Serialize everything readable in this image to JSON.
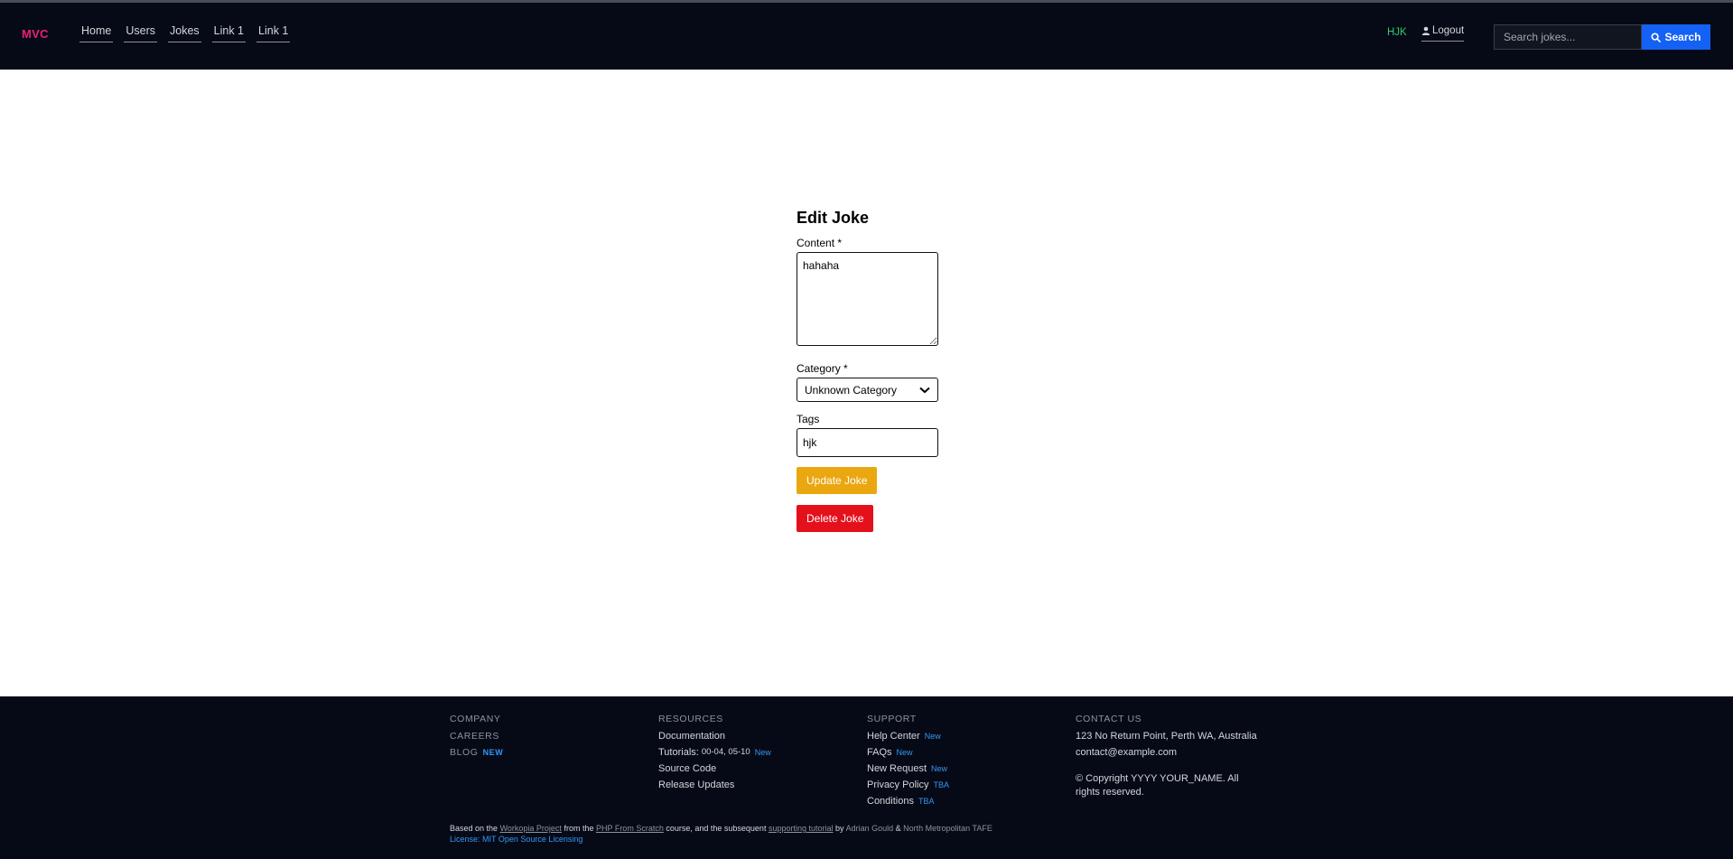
{
  "header": {
    "brand": "MVC",
    "nav": [
      "Home",
      "Users",
      "Jokes",
      "Link 1",
      "Link 1"
    ],
    "user": "HJK",
    "logout": "Logout",
    "search_placeholder": "Search jokes...",
    "search_button": "Search"
  },
  "form": {
    "title": "Edit Joke",
    "content_label": "Content *",
    "content_value": "hahaha",
    "category_label": "Category *",
    "category_value": "Unknown Category",
    "tags_label": "Tags",
    "tags_value": "hjk",
    "update_button": "Update Joke",
    "delete_button": "Delete Joke"
  },
  "footer": {
    "company": {
      "heading": "COMPANY",
      "careers": "CAREERS",
      "blog": "BLOG",
      "blog_badge": "NEW"
    },
    "resources": {
      "heading": "RESOURCES",
      "items": [
        {
          "label": "Documentation",
          "badge": ""
        },
        {
          "label": "Tutorials:",
          "extra": "00-04, 05-10",
          "badge": "New"
        },
        {
          "label": "Source Code",
          "badge": ""
        },
        {
          "label": "Release Updates",
          "badge": ""
        }
      ]
    },
    "support": {
      "heading": "SUPPORT",
      "items": [
        {
          "label": "Help Center",
          "badge": "New"
        },
        {
          "label": "FAQs",
          "badge": "New"
        },
        {
          "label": "New Request",
          "badge": "New"
        },
        {
          "label": "Privacy Policy",
          "badge": "TBA"
        },
        {
          "label": "Conditions",
          "badge": "TBA"
        }
      ]
    },
    "contact": {
      "heading": "CONTACT US",
      "address": "123 No Return Point, Perth WA, Australia",
      "email": "contact@example.com",
      "copyright": "© Copyright YYYY YOUR_NAME. All rights reserved."
    },
    "credits": {
      "based_on": "Based on the",
      "workopia": "Workopia Project",
      "from_the": "from the",
      "php": "PHP From Scratch",
      "course": "course, and the subsequent",
      "tutorial": "supporting tutorial",
      "by": "by",
      "author": "Adrian Gould",
      "amp": "&",
      "org": "North Metropolitan TAFE",
      "license": "License: MIT Open Source Licensing"
    }
  },
  "colors": {
    "header_bg": "#060a16",
    "brand": "#ec1e79",
    "user": "#2fcd6b",
    "search_button": "#1561f5",
    "update_button": "#eaa710",
    "delete_button": "#e4101c",
    "badge": "#3596f6"
  }
}
